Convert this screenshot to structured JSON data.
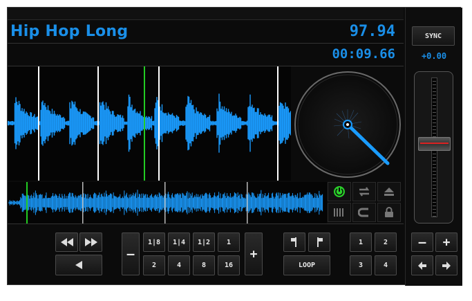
{
  "deck": {
    "track_title": "Hip Hop Long",
    "bpm": "97.94",
    "elapsed_time": "00:09.66"
  },
  "transport": {
    "rewind_icon": "rewind-icon",
    "fast_forward_icon": "fast-forward-icon",
    "play_reverse_icon": "play-left-icon"
  },
  "loop_sizes": {
    "minus_label": "–",
    "plus_label": "+",
    "top_row": [
      "1|8",
      "1|4",
      "1|2",
      "1"
    ],
    "bottom_row": [
      "2",
      "4",
      "8",
      "16"
    ]
  },
  "loop_controls": {
    "in_icon": "flag-in-icon",
    "out_icon": "flag-out-icon",
    "loop_label": "LOOP"
  },
  "hotcues": {
    "labels": [
      "1",
      "2",
      "3",
      "4"
    ]
  },
  "pitch": {
    "sync_label": "SYNC",
    "pitch_value": "+0.00",
    "minus_label": "–",
    "plus_label": "+",
    "nudge_left_icon": "arrow-left-icon",
    "nudge_right_icon": "arrow-right-icon"
  },
  "side_icons": [
    "power-icon",
    "loop-arrows-icon",
    "eject-icon",
    "beatgrid-icon",
    "magnet-icon",
    "lock-icon"
  ],
  "colors": {
    "accent": "#1a8fe8",
    "waveform": "#1a9cff",
    "playhead": "#22cc22",
    "beat_marker": "#ffffff"
  }
}
